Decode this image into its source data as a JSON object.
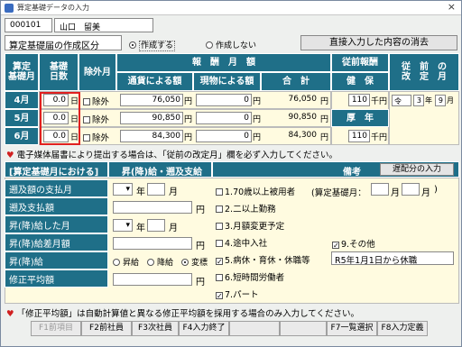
{
  "window": {
    "title": "算定基礎データの入力",
    "close": "×"
  },
  "header": {
    "employee_id": "000101",
    "employee_name": "山口　留美"
  },
  "kubun": {
    "label": "算定基礎届の作成区分",
    "opt_create": "作成する",
    "opt_nocreate": "作成しない",
    "clear_button": "直接入力した内容の消去"
  },
  "grid": {
    "h_month": "算定\n基礎月",
    "h_days": "基礎\n日数",
    "h_exclude": "除外月",
    "h_pay": "報　酬　月　額",
    "h_prev": "従前報酬",
    "h_rev": "従　前　の\n改　定　月",
    "h_cash": "通貨による額",
    "h_goods": "現物による額",
    "h_total": "合　計",
    "h_kenpo": "健　保",
    "rows": [
      {
        "month": "4月",
        "days": "0.0",
        "day_unit": "日",
        "exclude": "除外",
        "cash": "76,050",
        "goods": "0",
        "total": "76,050",
        "yen": "円"
      },
      {
        "month": "5月",
        "days": "0.0",
        "day_unit": "日",
        "exclude": "除外",
        "cash": "90,850",
        "goods": "0",
        "total": "90,850",
        "yen": "円"
      },
      {
        "month": "6月",
        "days": "0.0",
        "day_unit": "日",
        "exclude": "除外",
        "cash": "84,300",
        "goods": "0",
        "total": "84,300",
        "yen": "円"
      }
    ],
    "kenpo_val": "110",
    "kousei_val": "110",
    "senen": "千円",
    "kousei_lbl": "厚　年",
    "era": "令",
    "rev_year": "3",
    "rev_year_unit": "年",
    "rev_month": "9",
    "rev_month_unit": "月"
  },
  "note1": "電子媒体届書により提出する場合は、「従前の改定月」欄を必ず入力してください。",
  "lower": {
    "sec_title": "[算定基礎月における]",
    "sec_title2": "昇(降)給・遡及支給",
    "biko": "備考",
    "late_button": "遅配分の入力",
    "labels": [
      "遡及額の支払月",
      "遡及支払額",
      "昇(降)給した月",
      "昇(降)給差月額",
      "昇(降)給",
      "修正平均額"
    ],
    "year": "年",
    "month": "月",
    "yen": "円",
    "radio_up": "昇給",
    "radio_down": "降給",
    "radio_change": "変標",
    "checks": [
      "1.70歳以上被用者",
      "2.二以上勤務",
      "3.月額変更予定",
      "4.途中入社",
      "5.病休・育休・休職等",
      "6.短時間労働者",
      "7.パート"
    ],
    "check9": "9.その他",
    "santei_label": "(算定基礎月：",
    "santei_close": ")",
    "remark": "R5年1月1日から休職"
  },
  "note2": "「修正平均額」は自動計算値と異なる修正平均額を採用する場合のみ入力してください。",
  "fkeys": [
    "F1前項目",
    "F2前社員",
    "F3次社員",
    "F4入力終了",
    "",
    "",
    "F7一覧選択",
    "F8入力定義"
  ]
}
